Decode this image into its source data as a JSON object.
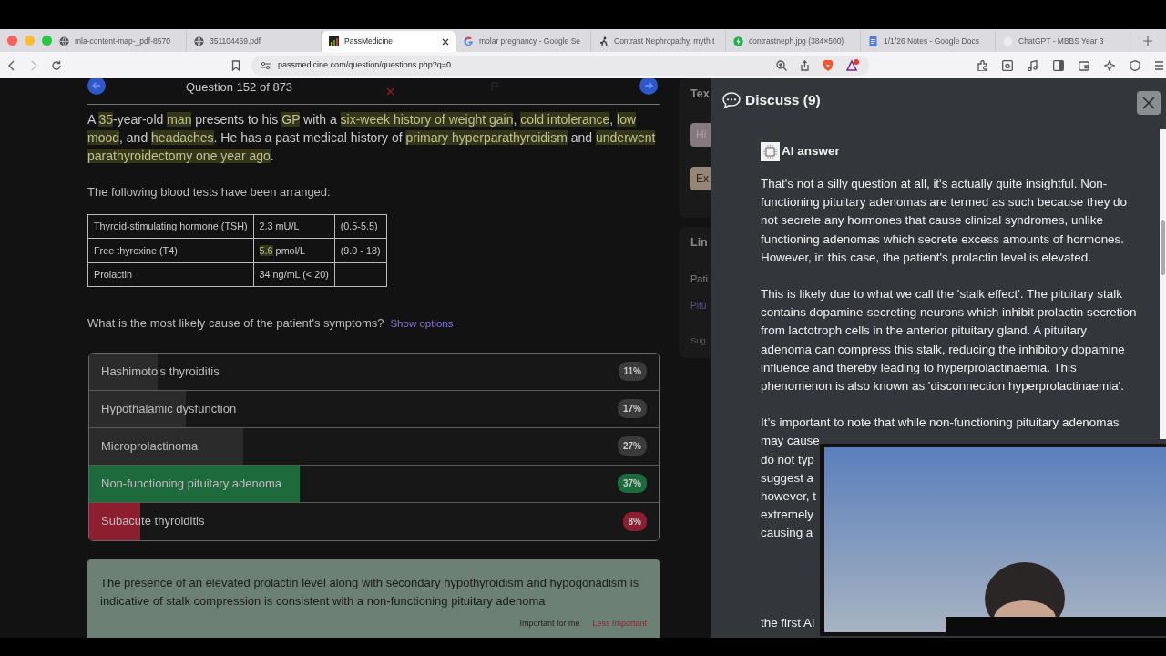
{
  "browser": {
    "tabs": [
      {
        "title": "mla-content-map-_pdf-8570",
        "kind": "globe",
        "selected": false
      },
      {
        "title": "351104459.pdf",
        "kind": "globe",
        "selected": false
      },
      {
        "title": "PassMedicine",
        "kind": "chart",
        "selected": true
      },
      {
        "title": "molar pregnancy - Google Se",
        "kind": "search",
        "selected": false
      },
      {
        "title": "Contrast Nephropathy, myth t",
        "kind": "runner",
        "selected": false
      },
      {
        "title": "contrastneph.jpg (384×500)",
        "kind": "bolt",
        "selected": false
      },
      {
        "title": "1/1/26 Notes - Google Docs",
        "kind": "document",
        "selected": false
      },
      {
        "title": "ChatGPT - MBBS Year 3",
        "kind": "blank",
        "selected": false
      }
    ],
    "url": "passmedicine.com/question/questions.php?q=0"
  },
  "question": {
    "counter": "Question 152 of 873",
    "stem": [
      {
        "text": "A ",
        "highlighted": false
      },
      {
        "text": "35",
        "highlighted": true
      },
      {
        "text": "-year-old ",
        "highlighted": false
      },
      {
        "text": "man",
        "highlighted": true
      },
      {
        "text": " presents to his ",
        "highlighted": false
      },
      {
        "text": "GP",
        "highlighted": true
      },
      {
        "text": " with a ",
        "highlighted": false
      },
      {
        "text": "six-week history of weight gain",
        "highlighted": true
      },
      {
        "text": ", ",
        "highlighted": false
      },
      {
        "text": "cold intolerance",
        "highlighted": true
      },
      {
        "text": ", ",
        "highlighted": false
      },
      {
        "text": "low mood",
        "highlighted": true
      },
      {
        "text": ", and ",
        "highlighted": false
      },
      {
        "text": "headaches",
        "highlighted": true
      },
      {
        "text": ". He has a past medical history of ",
        "highlighted": false
      },
      {
        "text": "primary hyperparathyroidism",
        "highlighted": true
      },
      {
        "text": " and ",
        "highlighted": false
      },
      {
        "text": "underwent parathyroidectomy one year ago",
        "highlighted": true
      },
      {
        "text": ".",
        "highlighted": false
      }
    ],
    "tests_intro": "The following blood tests have been arranged:",
    "tests": [
      [
        {
          "text": "Thyroid-stimulating hormone (TSH)",
          "highlighted": false
        },
        {
          "text": "2.3 mU/L",
          "highlighted": false
        },
        {
          "text": "(0.5-5.5)",
          "highlighted": false
        }
      ],
      [
        {
          "text": "Free thyroxine (T4)",
          "highlighted": false
        },
        {
          "text": "5.6 pmol/L",
          "highlighted": true
        },
        {
          "text": "(9.0 - 18)",
          "highlighted": false
        }
      ],
      [
        {
          "text": "Prolactin",
          "highlighted": false
        },
        {
          "text": "34 ng/mL (< 20)",
          "highlighted": false
        }
      ]
    ],
    "prompt": "What is the most likely cause of the patient's symptoms?",
    "show_options": "Show options",
    "options": [
      {
        "label": "Hashimoto's thyroiditis",
        "percent": "11%",
        "level": 0.12,
        "kind": "neutral"
      },
      {
        "label": "Hypothalamic dysfunction",
        "percent": "17%",
        "level": 0.17,
        "kind": "neutral"
      },
      {
        "label": "Microprolactinoma",
        "percent": "27%",
        "level": 0.27,
        "kind": "neutral"
      },
      {
        "label": "Non-functioning pituitary adenoma",
        "percent": "37%",
        "level": 0.37,
        "kind": "correct"
      },
      {
        "label": "Subacute thyroiditis",
        "percent": "8%",
        "level": 0.09,
        "kind": "wrong"
      }
    ],
    "explanation": {
      "text": "The presence of an elevated prolactin level along with secondary hypothyroidism and hypogonadism is indicative of stalk compression is consistent with a non-functioning pituitary adenoma",
      "important": "Important for me",
      "less_important": "Less Important"
    }
  },
  "side_panel": [
    {
      "kind": "card",
      "items": [
        {
          "kind": "heading",
          "text": "Tex"
        },
        {
          "kind": "pink-button",
          "text": "Hi"
        },
        {
          "kind": "tan-button",
          "text": "Ex"
        }
      ]
    },
    {
      "kind": "card",
      "items": [
        {
          "kind": "heading",
          "text": "Lin"
        },
        {
          "kind": "label",
          "text": "Pati"
        },
        {
          "kind": "link",
          "text": "Pitu"
        },
        {
          "kind": "small",
          "text": "Sug"
        }
      ]
    }
  ],
  "discuss": {
    "title": "Discuss (9)",
    "answer_label": "AI answer",
    "paragraphs": [
      "That's not a silly question at all, it's actually quite insightful. Non-functioning pituitary adenomas are termed as such because they do not secrete any hormones that cause clinical syndromes, unlike functioning adenomas which secrete excess amounts of hormones. However, in this case, the patient's prolactin level is elevated.",
      "This is likely due to what we call the 'stalk effect'. The pituitary stalk contains dopamine-secreting neurons which inhibit prolactin secretion from lactotroph cells in the anterior pituitary gland. A pituitary adenoma can compress this stalk, reducing the inhibitory dopamine influence and thereby leading to hyperprolactinaemia. This phenomenon is also known as 'disconnection hyperprolactinaemia'.",
      "It’s important to note that while non-functioning pituitary adenomas"
    ],
    "covered_lines": [
      "may cause",
      "do not typ",
      "suggest a",
      "however, t",
      "extremely",
      "causing a"
    ],
    "trailing_line": "the first AI"
  }
}
